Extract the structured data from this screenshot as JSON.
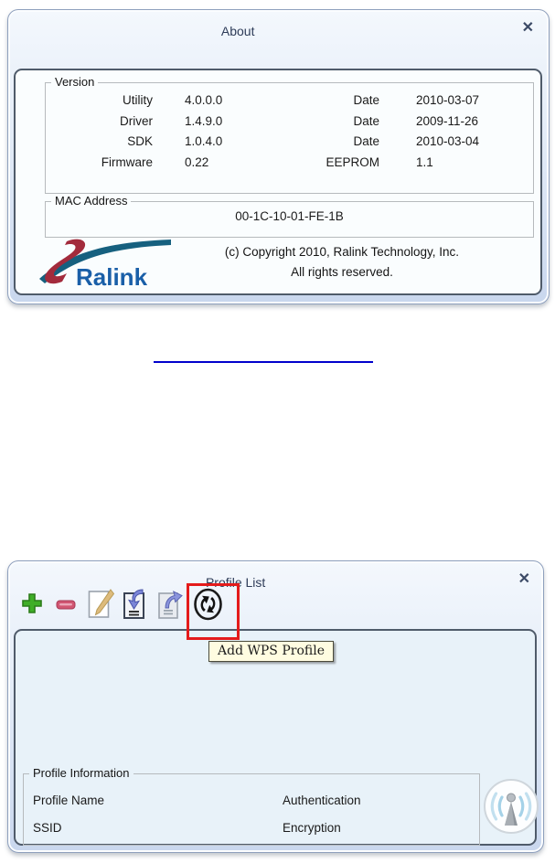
{
  "about_dialog": {
    "title": "About",
    "close_icon": "✕",
    "version_group": {
      "legend": "Version",
      "rows": [
        {
          "label": "Utility",
          "value": "4.0.0.0",
          "label2": "Date",
          "value2": "2010-03-07"
        },
        {
          "label": "Driver",
          "value": "1.4.9.0",
          "label2": "Date",
          "value2": "2009-11-26"
        },
        {
          "label": "SDK",
          "value": "1.0.4.0",
          "label2": "Date",
          "value2": "2010-03-04"
        },
        {
          "label": "Firmware",
          "value": "0.22",
          "label2": "EEPROM",
          "value2": "1.1"
        }
      ]
    },
    "mac_group": {
      "legend": "MAC Address",
      "value": "00-1C-10-01-FE-1B"
    },
    "logo": {
      "brand": "Ralink"
    },
    "copyright": {
      "line1": "(c) Copyright 2010, Ralink Technology, Inc.",
      "line2": "All rights reserved."
    }
  },
  "profile_dialog": {
    "title": "Profile List",
    "close_icon": "✕",
    "toolbar": {
      "icons": [
        {
          "name": "add-profile-icon"
        },
        {
          "name": "delete-profile-icon"
        },
        {
          "name": "edit-profile-icon"
        },
        {
          "name": "import-profile-icon"
        },
        {
          "name": "export-profile-icon"
        },
        {
          "name": "add-wps-profile-icon",
          "highlighted": true
        }
      ]
    },
    "tooltip": "Add WPS Profile",
    "profile_info_group": {
      "legend": "Profile Information",
      "fields": [
        {
          "label": "Profile Name"
        },
        {
          "label": "Authentication"
        },
        {
          "label": "SSID"
        },
        {
          "label": "Encryption"
        }
      ]
    }
  },
  "colors": {
    "highlight_red": "#e41b1b",
    "link_blue": "#0000cc",
    "tooltip_bg": "#fffce1",
    "dialog_border": "#8fa0bd",
    "panel_border": "#4f5b6a",
    "brand_blue": "#1a5fa8",
    "brand_teal": "#16607f",
    "brand_red": "#a32b3c",
    "plus_green": "#3fae27",
    "minus_pink": "#d15672",
    "signal_arc_blue": "#a5d2e8"
  }
}
